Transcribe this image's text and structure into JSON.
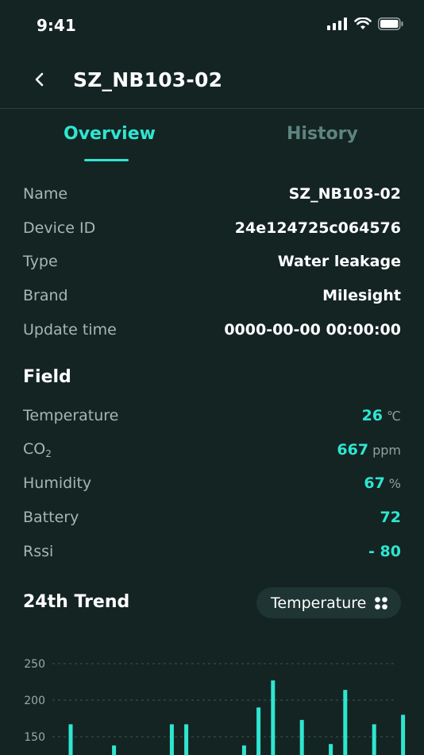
{
  "status_bar": {
    "time": "9:41"
  },
  "header": {
    "title": "SZ_NB103-02"
  },
  "tabs": [
    {
      "label": "Overview",
      "active": true
    },
    {
      "label": "History",
      "active": false
    }
  ],
  "info": [
    {
      "label": "Name",
      "value": "SZ_NB103-02"
    },
    {
      "label": "Device ID",
      "value": "24e124725c064576"
    },
    {
      "label": "Type",
      "value": "Water leakage"
    },
    {
      "label": "Brand",
      "value": "Milesight"
    },
    {
      "label": "Update time",
      "value": "0000-00-00 00:00:00"
    }
  ],
  "field": {
    "title": "Field",
    "temperature": {
      "label": "Temperature",
      "value": "26",
      "unit": "℃"
    },
    "co2": {
      "label": "CO",
      "sub": "2",
      "value": "667",
      "unit": "ppm"
    },
    "humidity": {
      "label": "Humidity",
      "value": "67",
      "unit": "%"
    },
    "battery": {
      "label": "Battery",
      "value": "72"
    },
    "rssi": {
      "label": "Rssi",
      "value": "- 80"
    }
  },
  "trend": {
    "title": "24th Trend",
    "selector_label": "Temperature"
  },
  "colors": {
    "accent": "#2ee6d0",
    "background": "#142423"
  },
  "chart_data": {
    "type": "bar",
    "yticks": [
      150,
      200,
      250
    ],
    "ylim": [
      125,
      260
    ],
    "values": [
      167,
      0,
      0,
      138,
      0,
      0,
      0,
      167,
      167,
      0,
      0,
      0,
      138,
      190,
      227,
      0,
      173,
      0,
      140,
      214,
      0,
      167,
      0,
      180
    ]
  }
}
